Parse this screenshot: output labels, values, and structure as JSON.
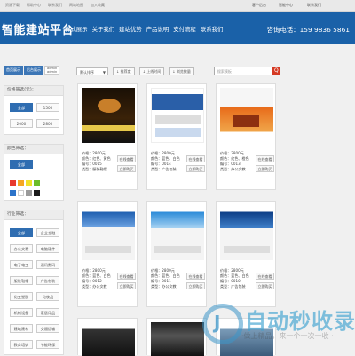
{
  "topbar": {
    "left_links": [
      "资源下载",
      "帮助中心",
      "联系我们",
      "网站地图",
      "加入收藏"
    ],
    "right_links": [
      "客户后台",
      "智能中心",
      "联系我们"
    ]
  },
  "header": {
    "logo": "智能建站平台",
    "nav": [
      "样式展示",
      "关于我们",
      "建站优势",
      "产品说明",
      "支付流程",
      "联系我们"
    ],
    "phone": "咨询电话：159 9836 5861"
  },
  "breadcrumb": [
    "首页展示",
    "后台展示"
  ],
  "admin_box": [
    "admin",
    "admin"
  ],
  "toolbar": {
    "select": "默认排序",
    "buttons": [
      "推荐度",
      "上线时间",
      "浏览数量"
    ],
    "search_placeholder": "搜索模板",
    "go": "Q"
  },
  "sidebar": {
    "price": {
      "title": "价格筛选(元)：",
      "options": [
        "全部",
        "1500",
        "2000",
        "2800"
      ],
      "selected": 0
    },
    "color": {
      "title": "颜色筛选：",
      "options": [
        "全部"
      ],
      "swatches": [
        "#e83a2e",
        "#f5a623",
        "#f0e12a",
        "#6dbd2a",
        "#2c73c9",
        "#ffffff",
        "#999999",
        "#1a1a1a"
      ]
    },
    "industry": {
      "title": "行业筛选：",
      "options": [
        "全部",
        "企业金融",
        "办公文教",
        "电脑硬件",
        "电子电工",
        "通讯数码",
        "服装鞋帽",
        "广告包装",
        "化工塑胶",
        "化妆品",
        "机械设备",
        "家居用品",
        "建筑建材",
        "交通运输",
        "教育培训",
        "节能环保"
      ],
      "selected": 0
    }
  },
  "cards": [
    {
      "price": "价格：2800元",
      "color": "颜色：红色、黄色",
      "id": "编号：0015",
      "type": "类型：服装鞋帽",
      "btn1": "在线查看",
      "btn2": "立即购买"
    },
    {
      "price": "价格：2800元",
      "color": "颜色：蓝色、白色",
      "id": "编号：0014",
      "type": "类型：广告包装",
      "btn1": "在线查看",
      "btn2": "立即购买"
    },
    {
      "price": "价格：2800元",
      "color": "颜色：红色、橙色",
      "id": "编号：0013",
      "type": "类型：办公文教",
      "btn1": "在线查看",
      "btn2": "立即购买"
    },
    {
      "price": "价格：2800元",
      "color": "颜色：蓝色、白色",
      "id": "编号：0012",
      "type": "类型：办公文教",
      "btn1": "在线查看",
      "btn2": "立即购买"
    },
    {
      "price": "价格：2800元",
      "color": "颜色：蓝色、白色",
      "id": "编号：0011",
      "type": "类型：办公文教",
      "btn1": "在线查看",
      "btn2": "立即购买"
    },
    {
      "price": "价格：2800元",
      "color": "颜色：蓝色、白色",
      "id": "编号：0010",
      "type": "类型：广告包装",
      "btn1": "在线查看",
      "btn2": "立即购买"
    }
  ],
  "watermark": {
    "title": "自动秒收录",
    "sub": "·做上精品，来一个一次一收 ·"
  }
}
